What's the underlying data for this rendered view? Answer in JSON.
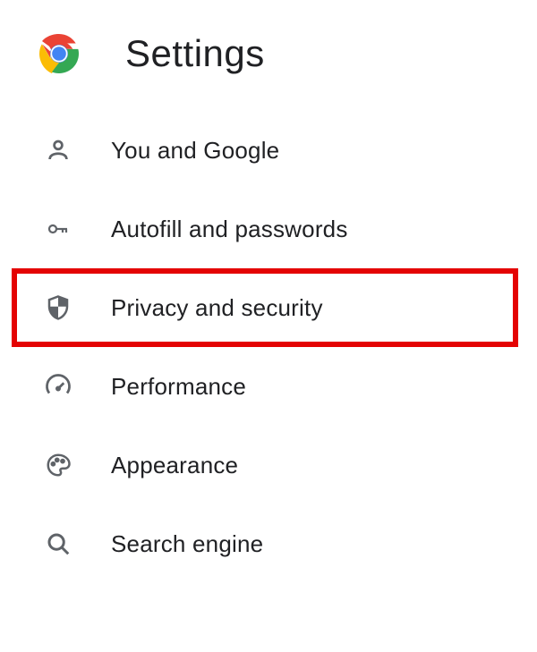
{
  "header": {
    "title": "Settings"
  },
  "sidebar": {
    "items": [
      {
        "label": "You and Google",
        "icon": "user-icon"
      },
      {
        "label": "Autofill and passwords",
        "icon": "key-icon"
      },
      {
        "label": "Privacy and security",
        "icon": "shield-icon",
        "highlighted": true
      },
      {
        "label": "Performance",
        "icon": "speedometer-icon"
      },
      {
        "label": "Appearance",
        "icon": "palette-icon"
      },
      {
        "label": "Search engine",
        "icon": "search-icon"
      }
    ]
  }
}
